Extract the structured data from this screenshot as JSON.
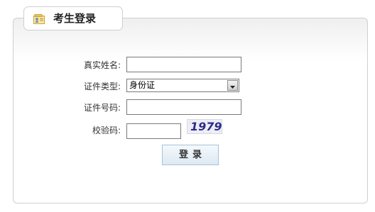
{
  "header": {
    "title": "考生登录",
    "icon": "id-card-icon"
  },
  "form": {
    "name_label": "真实姓名:",
    "name_value": "",
    "id_type_label": "证件类型:",
    "id_type_selected": "身份证",
    "id_number_label": "证件号码:",
    "id_number_value": "",
    "captcha_label": "校验码:",
    "captcha_value": "",
    "captcha_image_text": "1979"
  },
  "actions": {
    "login_label": "登录"
  },
  "colors": {
    "panel_border": "#cfcfcf",
    "button_border": "#a9c2d6",
    "captcha_text": "#2c2c8a"
  }
}
